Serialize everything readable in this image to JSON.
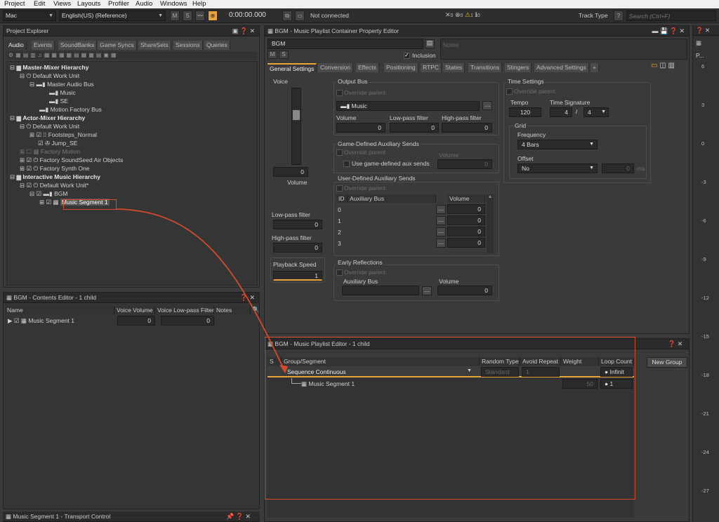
{
  "menu": [
    "Project",
    "Edit",
    "Views",
    "Layouts",
    "Profiler",
    "Audio",
    "Windows",
    "Help"
  ],
  "toolbar": {
    "platform": "Mac",
    "language": "English(US) (Reference)",
    "time": "0:00:00.000",
    "connection": "Not connected",
    "counts": {
      "errors": "0",
      "error2": "0",
      "warnings": "1",
      "info": "0"
    },
    "track_type": "Track Type",
    "help": "?",
    "search_placeholder": "Search (Ctrl+F)"
  },
  "project_explorer": {
    "title": "Project Explorer",
    "tabs": [
      "Audio",
      "Events",
      "SoundBanks",
      "Game Syncs",
      "ShareSets",
      "Sessions",
      "Queries"
    ],
    "tree": [
      {
        "label": "Master-Mixer Hierarchy",
        "level": 0,
        "bold": true
      },
      {
        "label": "Default Work Unit",
        "level": 1
      },
      {
        "label": "Master Audio Bus",
        "level": 2
      },
      {
        "label": "Music",
        "level": 3
      },
      {
        "label": "SE",
        "level": 3
      },
      {
        "label": "Motion Factory Bus",
        "level": 2
      },
      {
        "label": "Actor-Mixer Hierarchy",
        "level": 0,
        "bold": true
      },
      {
        "label": "Default Work Unit",
        "level": 1
      },
      {
        "label": "Footsteps_Normal",
        "level": 2
      },
      {
        "label": "Jump_SE",
        "level": 2
      },
      {
        "label": "Factory Motion",
        "level": 1,
        "dim": true
      },
      {
        "label": "Factory SoundSeed Air Objects",
        "level": 1
      },
      {
        "label": "Factory Synth One",
        "level": 1
      },
      {
        "label": "Interactive Music Hierarchy",
        "level": 0,
        "bold": true
      },
      {
        "label": "Default Work Unit*",
        "level": 1
      },
      {
        "label": "BGM",
        "level": 2
      },
      {
        "label": "Music Segment 1",
        "level": 3,
        "selected": true
      }
    ]
  },
  "contents_editor": {
    "title": "BGM - Contents Editor - 1 child",
    "columns": [
      "Name",
      "Voice Volume",
      "Voice Low-pass Filter",
      "Notes"
    ],
    "row": {
      "name": "Music Segment 1",
      "volume": "0",
      "lpf": "0"
    }
  },
  "transport": {
    "title": "Music Segment 1 - Transport Control"
  },
  "property_editor": {
    "title": "BGM - Music Playlist Container Property Editor",
    "name": "BGM",
    "notes_placeholder": "Notes",
    "m": "M",
    "s": "S",
    "inclusion": "Inclusion",
    "tabs": [
      "General Settings",
      "Conversion",
      "Effects",
      "Positioning",
      "RTPC",
      "States",
      "Transitions",
      "Stingers",
      "Advanced Settings",
      "+"
    ],
    "voice": "Voice",
    "voice_value": "0",
    "volume_label": "Volume",
    "lpf_label": "Low-pass filter",
    "lpf_value": "0",
    "hpf_label": "High-pass filter",
    "hpf_value": "0",
    "playback_speed": "Playback Speed",
    "playback_value": "1",
    "output_bus": {
      "title": "Output Bus",
      "override": "Override parent",
      "bus": "Music",
      "volume": "Volume",
      "lpf": "Low-pass filter",
      "hpf": "High-pass filter",
      "v1": "0",
      "v2": "0",
      "v3": "0"
    },
    "game_aux": {
      "title": "Game-Defined Auxiliary Sends",
      "override": "Override parent",
      "use": "Use game-defined aux sends",
      "volume": "Volume",
      "value": "0"
    },
    "user_aux": {
      "title": "User-Defined Auxiliary Sends",
      "override": "Override parent",
      "cols": [
        "ID",
        "Auxiliary Bus",
        "Volume"
      ],
      "rows": [
        {
          "id": "0",
          "vol": "0"
        },
        {
          "id": "1",
          "vol": "0"
        },
        {
          "id": "2",
          "vol": "0"
        },
        {
          "id": "3",
          "vol": "0"
        }
      ]
    },
    "early": {
      "title": "Early Reflections",
      "override": "Override parent",
      "aux": "Auxiliary Bus",
      "volume": "Volume",
      "value": "0"
    },
    "time": {
      "title": "Time Settings",
      "override": "Override parent",
      "tempo_label": "Tempo",
      "tempo": "120",
      "sig_label": "Time Signature",
      "sig_num": "4",
      "slash": "/",
      "sig_den": "4",
      "grid": "Grid",
      "freq_label": "Frequency",
      "freq": "4 Bars",
      "offset_label": "Offset",
      "offset": "No",
      "offset_value": "0",
      "ms": "ms"
    }
  },
  "playlist_editor": {
    "title": "BGM - Music Playlist Editor - 1 child",
    "columns": [
      "S",
      "Group/Segment",
      "Random Type",
      "Avoid Repeat",
      "Weight",
      "Loop Count"
    ],
    "group": {
      "name": "Sequence Continuous",
      "random_type": "Standard",
      "avoid": "1",
      "loop": "Infinit"
    },
    "segment": {
      "name": "Music Segment 1",
      "weight": "50",
      "loop": "1"
    },
    "new_group": "New Group"
  },
  "meter": {
    "label": "P...",
    "ticks": [
      "6",
      "3",
      "0",
      "-3",
      "-6",
      "-9",
      "-12",
      "-15",
      "-18",
      "-21",
      "-24",
      "-27"
    ]
  },
  "colors": {
    "accent": "#e8a33a",
    "annotation": "#d24a2e"
  }
}
